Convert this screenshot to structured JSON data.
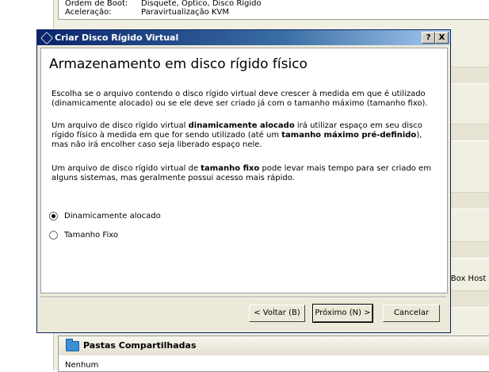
{
  "background": {
    "details": [
      {
        "key": "Ordem de Boot:",
        "value": "Disquete, Óptico, Disco Rígido"
      },
      {
        "key": "Aceleração:",
        "value": "Paravirtualização KVM"
      }
    ],
    "vbox_host_fragment": "lBox Host",
    "shared_folders": {
      "title": "Pastas Compartilhadas",
      "value": "Nenhum"
    }
  },
  "dialog": {
    "title": "Criar Disco Rígido Virtual",
    "help_label": "?",
    "close_label": "X",
    "page_title": "Armazenamento em disco rígido físico",
    "para1": "Escolha se o arquivo contendo o disco rígido virtual deve crescer à medida em que é utilizado (dinamicamente alocado) ou se ele deve ser criado já com o tamanho máximo (tamanho fixo).",
    "para2": {
      "t1": "Um arquivo de disco rígido virtual ",
      "b1": "dinamicamente alocado",
      "t2": " irá utilizar espaço em seu disco rígido físico à medida em que for sendo utilizado (até um ",
      "b2": "tamanho máximo pré-definido",
      "t3": "), mas não irá encolher caso seja liberado espaço nele."
    },
    "para3": {
      "t1": "Um arquivo de disco rígido virtual de ",
      "b1": "tamanho fixo",
      "t2": " pode levar mais tempo para ser criado em alguns sistemas, mas geralmente possui acesso mais rápido."
    },
    "options": [
      {
        "label": "Dinamicamente alocado",
        "checked": true
      },
      {
        "label": "Tamanho Fixo",
        "checked": false
      }
    ],
    "buttons": {
      "back": "< Voltar (B)",
      "next": "Próximo (N) >",
      "cancel": "Cancelar"
    }
  }
}
